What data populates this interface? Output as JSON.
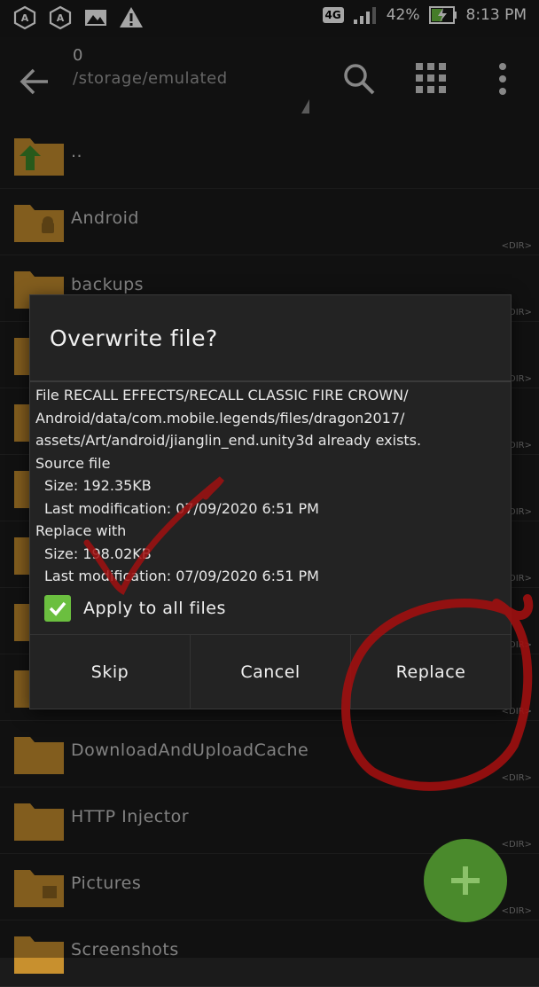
{
  "status_bar": {
    "network": "4G",
    "battery": "42%",
    "time": "8:13 PM"
  },
  "toolbar": {
    "path_top": "0",
    "path": "/storage/emulated"
  },
  "files": [
    {
      "name": "..",
      "dir": ""
    },
    {
      "name": "Android",
      "dir": "<DIR>"
    },
    {
      "name": "backups",
      "dir": "<DIR>"
    },
    {
      "name": "",
      "dir": "<DIR>"
    },
    {
      "name": "",
      "dir": "<DIR>"
    },
    {
      "name": "",
      "dir": "<DIR>"
    },
    {
      "name": "",
      "dir": "<DIR>"
    },
    {
      "name": "",
      "dir": "<DIR>"
    },
    {
      "name": "",
      "dir": "<DIR>"
    },
    {
      "name": "DownloadAndUploadCache",
      "dir": "<DIR>"
    },
    {
      "name": "HTTP Injector",
      "dir": "<DIR>"
    },
    {
      "name": "Pictures",
      "dir": "<DIR>"
    },
    {
      "name": "Screenshots",
      "dir": ""
    }
  ],
  "dialog": {
    "title": "Overwrite file?",
    "message_line1": "File RECALL EFFECTS/RECALL CLASSIC FIRE CROWN/",
    "message_line2": "Android/data/com.mobile.legends/files/dragon2017/",
    "message_line3": "assets/Art/android/jianglin_end.unity3d already exists.",
    "source_label": "Source file",
    "source_size": "Size: 192.35KB",
    "source_modified": "Last modification: 07/09/2020 6:51 PM",
    "replace_label": "Replace with",
    "replace_size": "Size: 198.02KB",
    "replace_modified": "Last modification: 07/09/2020 6:51 PM",
    "apply_all_label": "Apply to all files",
    "apply_all_checked": true,
    "buttons": {
      "skip": "Skip",
      "cancel": "Cancel",
      "replace": "Replace"
    }
  },
  "colors": {
    "folder": "#c8902e",
    "accent_green": "#6bbf3f",
    "annotation_red": "#a01010"
  }
}
